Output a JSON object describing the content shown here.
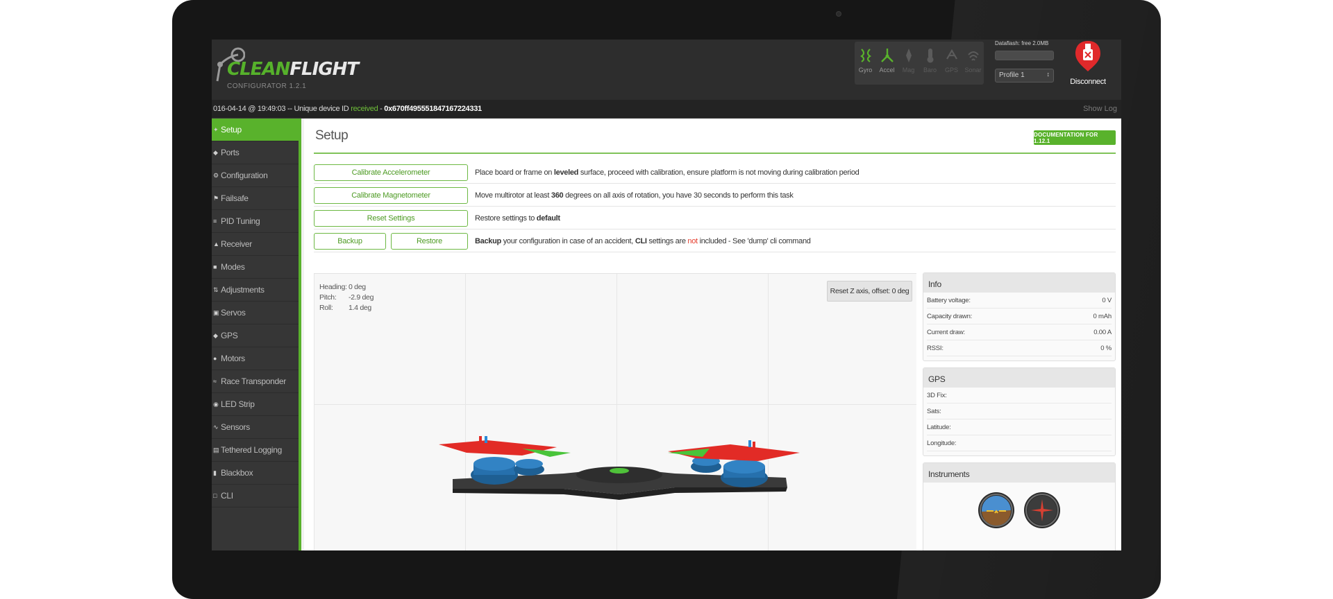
{
  "header": {
    "logo_text_a": "CLEAN",
    "logo_text_b": "FLIGHT",
    "logo_sub": "CONFIGURATOR 1.2.1",
    "sensors": [
      {
        "label": "Gyro",
        "icon": "gyro-icon",
        "active": true
      },
      {
        "label": "Accel",
        "icon": "accel-icon",
        "active": true
      },
      {
        "label": "Mag",
        "icon": "mag-icon",
        "active": false
      },
      {
        "label": "Baro",
        "icon": "baro-icon",
        "active": false
      },
      {
        "label": "GPS",
        "icon": "gps-icon",
        "active": false
      },
      {
        "label": "Sonar",
        "icon": "sonar-icon",
        "active": false
      }
    ],
    "dataflash_label": "Dataflash: free 2.0MB",
    "profile_value": "Profile 1",
    "disconnect_label": "Disconnect"
  },
  "log": {
    "prefix": "016-04-14 @ 19:49:03 -- Unique device ID ",
    "status": "received",
    "sep": " - ",
    "device_id": "0x670ff495551847167224331",
    "show_log": "Show Log"
  },
  "sidebar": {
    "items": [
      {
        "label": "Setup",
        "icon": "wrench-icon"
      },
      {
        "label": "Ports",
        "icon": "plug-icon"
      },
      {
        "label": "Configuration",
        "icon": "gear-icon"
      },
      {
        "label": "Failsafe",
        "icon": "failsafe-icon"
      },
      {
        "label": "PID Tuning",
        "icon": "sliders-icon"
      },
      {
        "label": "Receiver",
        "icon": "receiver-icon"
      },
      {
        "label": "Modes",
        "icon": "modes-icon"
      },
      {
        "label": "Adjustments",
        "icon": "adjust-icon"
      },
      {
        "label": "Servos",
        "icon": "servo-icon"
      },
      {
        "label": "GPS",
        "icon": "gps-icon"
      },
      {
        "label": "Motors",
        "icon": "motor-icon"
      },
      {
        "label": "Race Transponder",
        "icon": "transponder-icon"
      },
      {
        "label": "LED Strip",
        "icon": "led-icon"
      },
      {
        "label": "Sensors",
        "icon": "sensors-icon"
      },
      {
        "label": "Tethered Logging",
        "icon": "logging-icon"
      },
      {
        "label": "Blackbox",
        "icon": "blackbox-icon"
      },
      {
        "label": "CLI",
        "icon": "cli-icon"
      }
    ]
  },
  "setup": {
    "title": "Setup",
    "doc_button": "DOCUMENTATION FOR 1.12.1",
    "calibrate_acc": "Calibrate Accelerometer",
    "calibrate_acc_desc_1": "Place board or frame on ",
    "calibrate_acc_desc_b": "leveled",
    "calibrate_acc_desc_2": " surface, proceed with calibration, ensure platform is not moving during calibration period",
    "calibrate_mag": "Calibrate Magnetometer",
    "calibrate_mag_desc_1": "Move multirotor at least ",
    "calibrate_mag_desc_b": "360",
    "calibrate_mag_desc_2": " degrees on all axis of rotation, you have 30 seconds to perform this task",
    "reset": "Reset Settings",
    "reset_desc_1": "Restore settings to ",
    "reset_desc_b": "default",
    "backup": "Backup",
    "restore": "Restore",
    "backup_desc_b1": "Backup",
    "backup_desc_1": " your configuration in case of an accident, ",
    "backup_desc_b2": "CLI",
    "backup_desc_2": " settings are ",
    "backup_desc_red": "not",
    "backup_desc_3": " included - See 'dump' cli command"
  },
  "attitude": {
    "heading_label": "Heading:",
    "heading_value": "0 deg",
    "pitch_label": "Pitch:",
    "pitch_value": "-2.9 deg",
    "roll_label": "Roll:",
    "roll_value": "1.4 deg",
    "reset_z": "Reset Z axis, offset: 0 deg"
  },
  "info": {
    "title": "Info",
    "rows": [
      {
        "label": "Battery voltage:",
        "value": "0 V"
      },
      {
        "label": "Capacity drawn:",
        "value": "0 mAh"
      },
      {
        "label": "Current draw:",
        "value": "0.00 A"
      },
      {
        "label": "RSSI:",
        "value": "0 %"
      }
    ]
  },
  "gps": {
    "title": "GPS",
    "rows": [
      {
        "label": "3D Fix:",
        "value": ""
      },
      {
        "label": "Sats:",
        "value": ""
      },
      {
        "label": "Latitude:",
        "value": ""
      },
      {
        "label": "Longitude:",
        "value": ""
      }
    ]
  },
  "instruments": {
    "title": "Instruments",
    "items": [
      "attitude-indicator-icon",
      "heading-indicator-icon"
    ]
  },
  "colors": {
    "accent": "#59b22c",
    "header_bg": "#2d2d2d",
    "sidebar_bg": "#363636",
    "alert": "#e53b2b"
  }
}
